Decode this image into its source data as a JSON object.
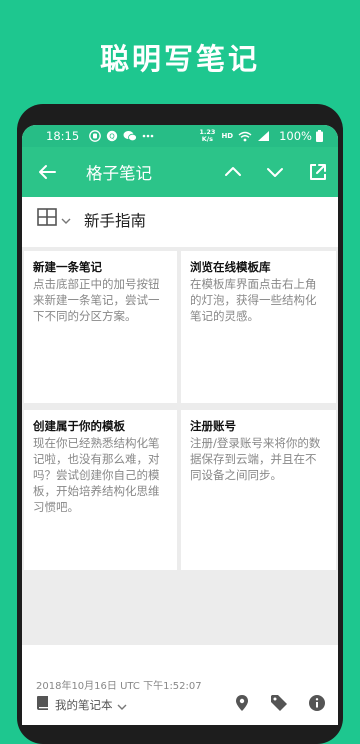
{
  "headline": "聪明写笔记",
  "status_bar": {
    "time": "18:15",
    "net_speed_value": "1.23",
    "net_speed_unit": "K/s",
    "hd": "HD",
    "battery_percent": "100%"
  },
  "toolbar": {
    "title": "格子笔记"
  },
  "note": {
    "title": "新手指南",
    "cells": [
      {
        "heading": "新建一条笔记",
        "body": "点击底部正中的加号按钮来新建一条笔记，尝试一下不同的分区方案。"
      },
      {
        "heading": "浏览在线模板库",
        "body": "在模板库界面点击右上角的灯泡，获得一些结构化笔记的灵感。"
      },
      {
        "heading": "创建属于你的模板",
        "body": "现在你已经熟悉结构化笔记啦，也没有那么难，对吗？尝试创建你自己的模板，开始培养结构化思维习惯吧。"
      },
      {
        "heading": "注册账号",
        "body": "注册/登录账号来将你的数据保存到云端，并且在不同设备之间同步。"
      }
    ],
    "timestamp": "2018年10月16日 UTC 下午1:52:07",
    "notebook": "我的笔记本"
  },
  "colors": {
    "brand_green": "#1ec78f",
    "toolbar_green": "#2cc489"
  }
}
